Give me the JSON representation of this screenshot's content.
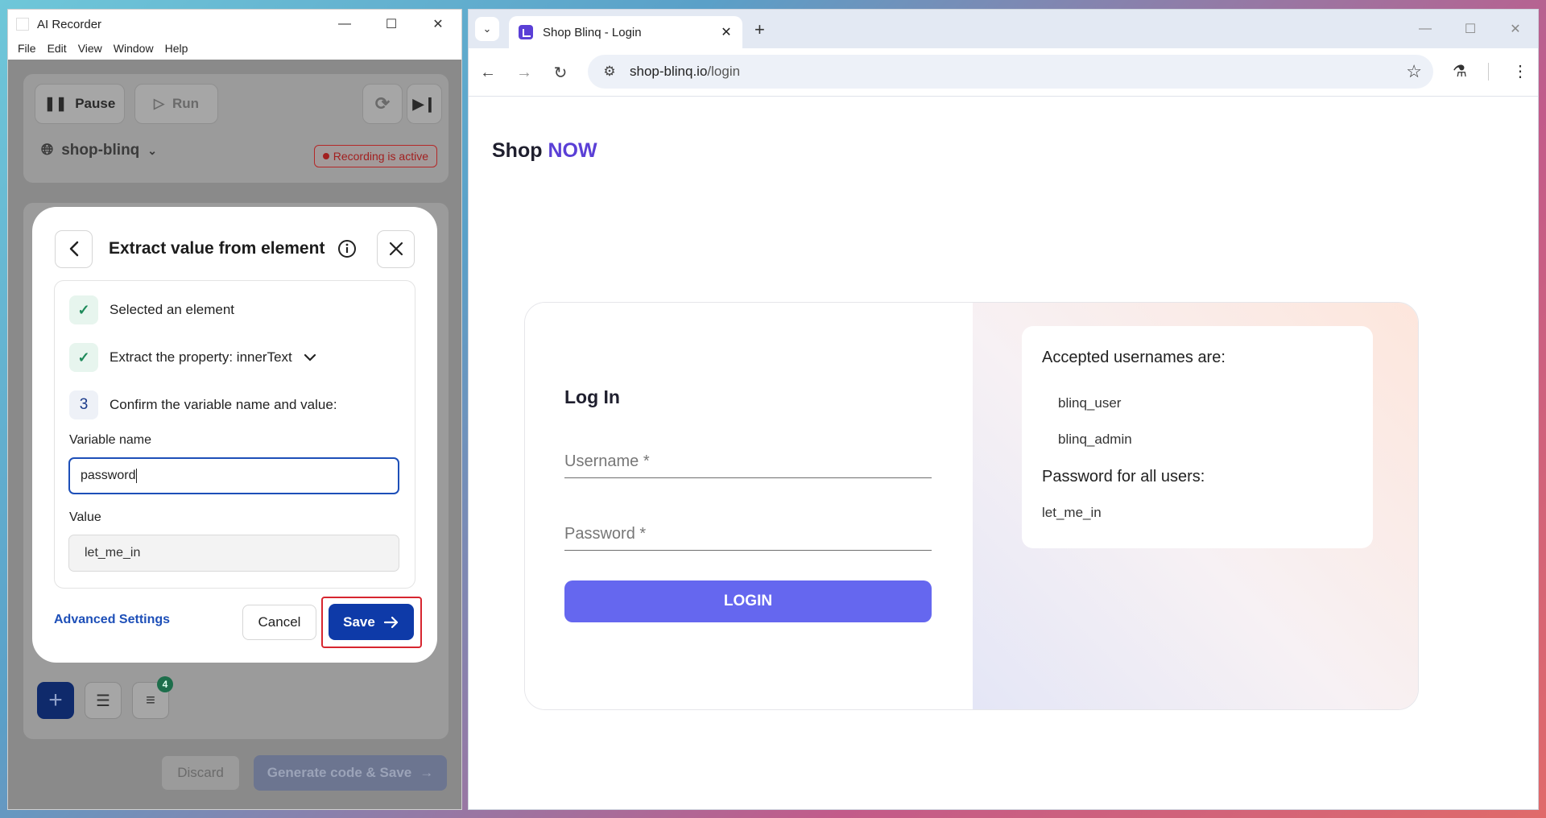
{
  "app": {
    "title": "AI Recorder",
    "menu": [
      "File",
      "Edit",
      "View",
      "Window",
      "Help"
    ],
    "pause_label": "Pause",
    "run_label": "Run",
    "project": "shop-blinq",
    "recording_status": "Recording is active",
    "badge_count": "4",
    "discard_label": "Discard",
    "generate_label": "Generate code & Save"
  },
  "dialog": {
    "title": "Extract value from element",
    "steps": [
      "Selected an element",
      "Extract the property: innerText",
      "Confirm the variable name and value:"
    ],
    "step3_number": "3",
    "variable_label": "Variable name",
    "variable_value": "password",
    "value_label": "Value",
    "value_text": "let_me_in",
    "advanced_label": "Advanced Settings",
    "cancel_label": "Cancel",
    "save_label": "Save"
  },
  "browser": {
    "tab_title": "Shop Blinq - Login",
    "url_host": "shop-blinq.io",
    "url_path": "/login"
  },
  "page": {
    "brand_shop": "Shop",
    "brand_now": "NOW",
    "login_heading": "Log In",
    "username_placeholder": "Username *",
    "password_placeholder": "Password *",
    "login_button": "LOGIN",
    "accepted_heading": "Accepted usernames are:",
    "usernames": [
      "blinq_user",
      "blinq_admin"
    ],
    "password_heading": "Password for all users:",
    "password_value": "let_me_in"
  },
  "colors": {
    "accent": "#5a3fd6",
    "login_button": "#6567ef",
    "save_button": "#0e3aa8",
    "highlight": "#d7262f"
  }
}
